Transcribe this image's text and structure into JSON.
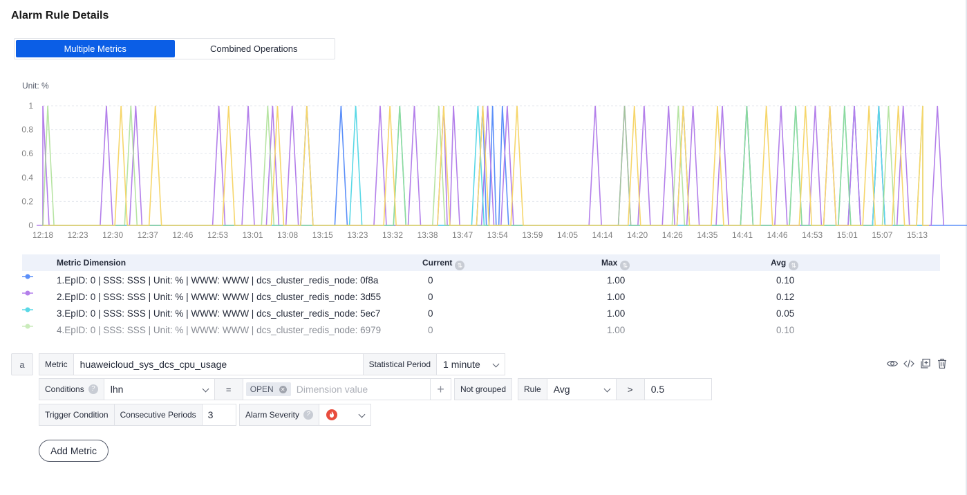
{
  "page": {
    "title": "Alarm Rule Details"
  },
  "tabs": [
    {
      "label": "Multiple Metrics",
      "active": true
    },
    {
      "label": "Combined Operations",
      "active": false
    }
  ],
  "chart_data": {
    "type": "line",
    "unit_label": "Unit: %",
    "ylim": [
      0,
      1
    ],
    "y_ticks": [
      "0",
      "0.2",
      "0.4",
      "0.6",
      "0.8",
      "1"
    ],
    "x_labels": [
      "12:18",
      "12:23",
      "12:30",
      "12:37",
      "12:46",
      "12:53",
      "13:01",
      "13:08",
      "13:15",
      "13:23",
      "13:32",
      "13:38",
      "13:47",
      "13:54",
      "13:59",
      "14:05",
      "14:14",
      "14:20",
      "14:26",
      "14:35",
      "14:41",
      "14:46",
      "14:53",
      "15:01",
      "15:07",
      "15:13"
    ],
    "grid": true,
    "series": [
      {
        "name": "1.EpID: 0 | SSS: SSS | Unit: % | WWW: WWW | dcs_cluster_redis_node: 0f8a",
        "color": "#5b8ff9",
        "spikes": [
          13.12,
          13.19,
          13.48,
          13.5,
          13.52,
          14.29,
          15.04,
          15.09,
          15.33
        ],
        "current": "0",
        "max": "1.00",
        "avg": "0.10"
      },
      {
        "name": "2.EpID: 0 | SSS: SSS | Unit: % | WWW: WWW | dcs_cluster_redis_node: 3d55",
        "color": "#b37fea",
        "spikes": [
          12.18,
          12.31,
          12.37,
          12.54,
          13.0,
          13.05,
          13.09,
          13.27,
          13.34,
          13.4,
          13.42,
          13.49,
          13.53,
          14.11,
          14.17,
          14.21,
          14.26,
          14.31,
          14.37,
          14.42,
          14.49,
          14.56,
          14.59,
          15.04,
          15.09,
          15.14,
          15.21
        ],
        "current": "0",
        "max": "1.00",
        "avg": "0.12"
      },
      {
        "name": "3.EpID: 0 | SSS: SSS | Unit: % | WWW: WWW | dcs_cluster_redis_node: 5ec7",
        "color": "#5ad8e6",
        "spikes": [
          13.22,
          13.31,
          13.47,
          14.42,
          14.52,
          15.02,
          15.09
        ],
        "current": "0",
        "max": "1.00",
        "avg": "0.05"
      },
      {
        "name": "4.EpID: 0 | SSS: SSS | Unit: % | WWW: WWW | dcs_cluster_redis_node: 6979",
        "color": "#9fdb84",
        "spikes": [
          12.19,
          12.36,
          13.04,
          13.31,
          13.39,
          14.17,
          14.28,
          14.42,
          14.52,
          15.02,
          15.11,
          15.18
        ],
        "current": "0",
        "max": "1.00",
        "avg": "0.10",
        "faded": true
      },
      {
        "name": "",
        "color": "#f6d66b",
        "spikes": [
          12.34,
          12.41,
          12.56,
          13.06,
          13.12,
          13.29,
          13.4,
          13.48,
          13.55,
          14.19,
          14.29,
          14.36,
          14.46,
          14.54,
          14.59,
          15.07,
          15.13,
          15.18
        ]
      }
    ]
  },
  "legend": {
    "headers": {
      "dimension": "Metric Dimension",
      "current": "Current",
      "max": "Max",
      "avg": "Avg"
    }
  },
  "rule": {
    "badge": "a",
    "metric_label": "Metric",
    "metric_value": "huaweicloud_sys_dcs_cpu_usage",
    "stat_period_label": "Statistical Period",
    "stat_period_value": "1 minute",
    "conditions_label": "Conditions",
    "conditions_value": "lhn",
    "operator": "=",
    "tag": "OPEN",
    "dimension_placeholder": "Dimension value",
    "plus": "+",
    "not_grouped": "Not grouped",
    "rule_label": "Rule",
    "rule_value": "Avg",
    "comparator": ">",
    "threshold": "0.5",
    "trigger_label": "Trigger Condition",
    "consecutive_label": "Consecutive Periods",
    "consecutive_value": "3",
    "severity_label": "Alarm Severity",
    "severity_icon": "critical-fire-icon",
    "severity_color": "#e84c3d",
    "add_metric": "Add Metric"
  },
  "toolbar_icons": [
    "eye-icon",
    "code-icon",
    "copy-icon",
    "delete-icon"
  ]
}
